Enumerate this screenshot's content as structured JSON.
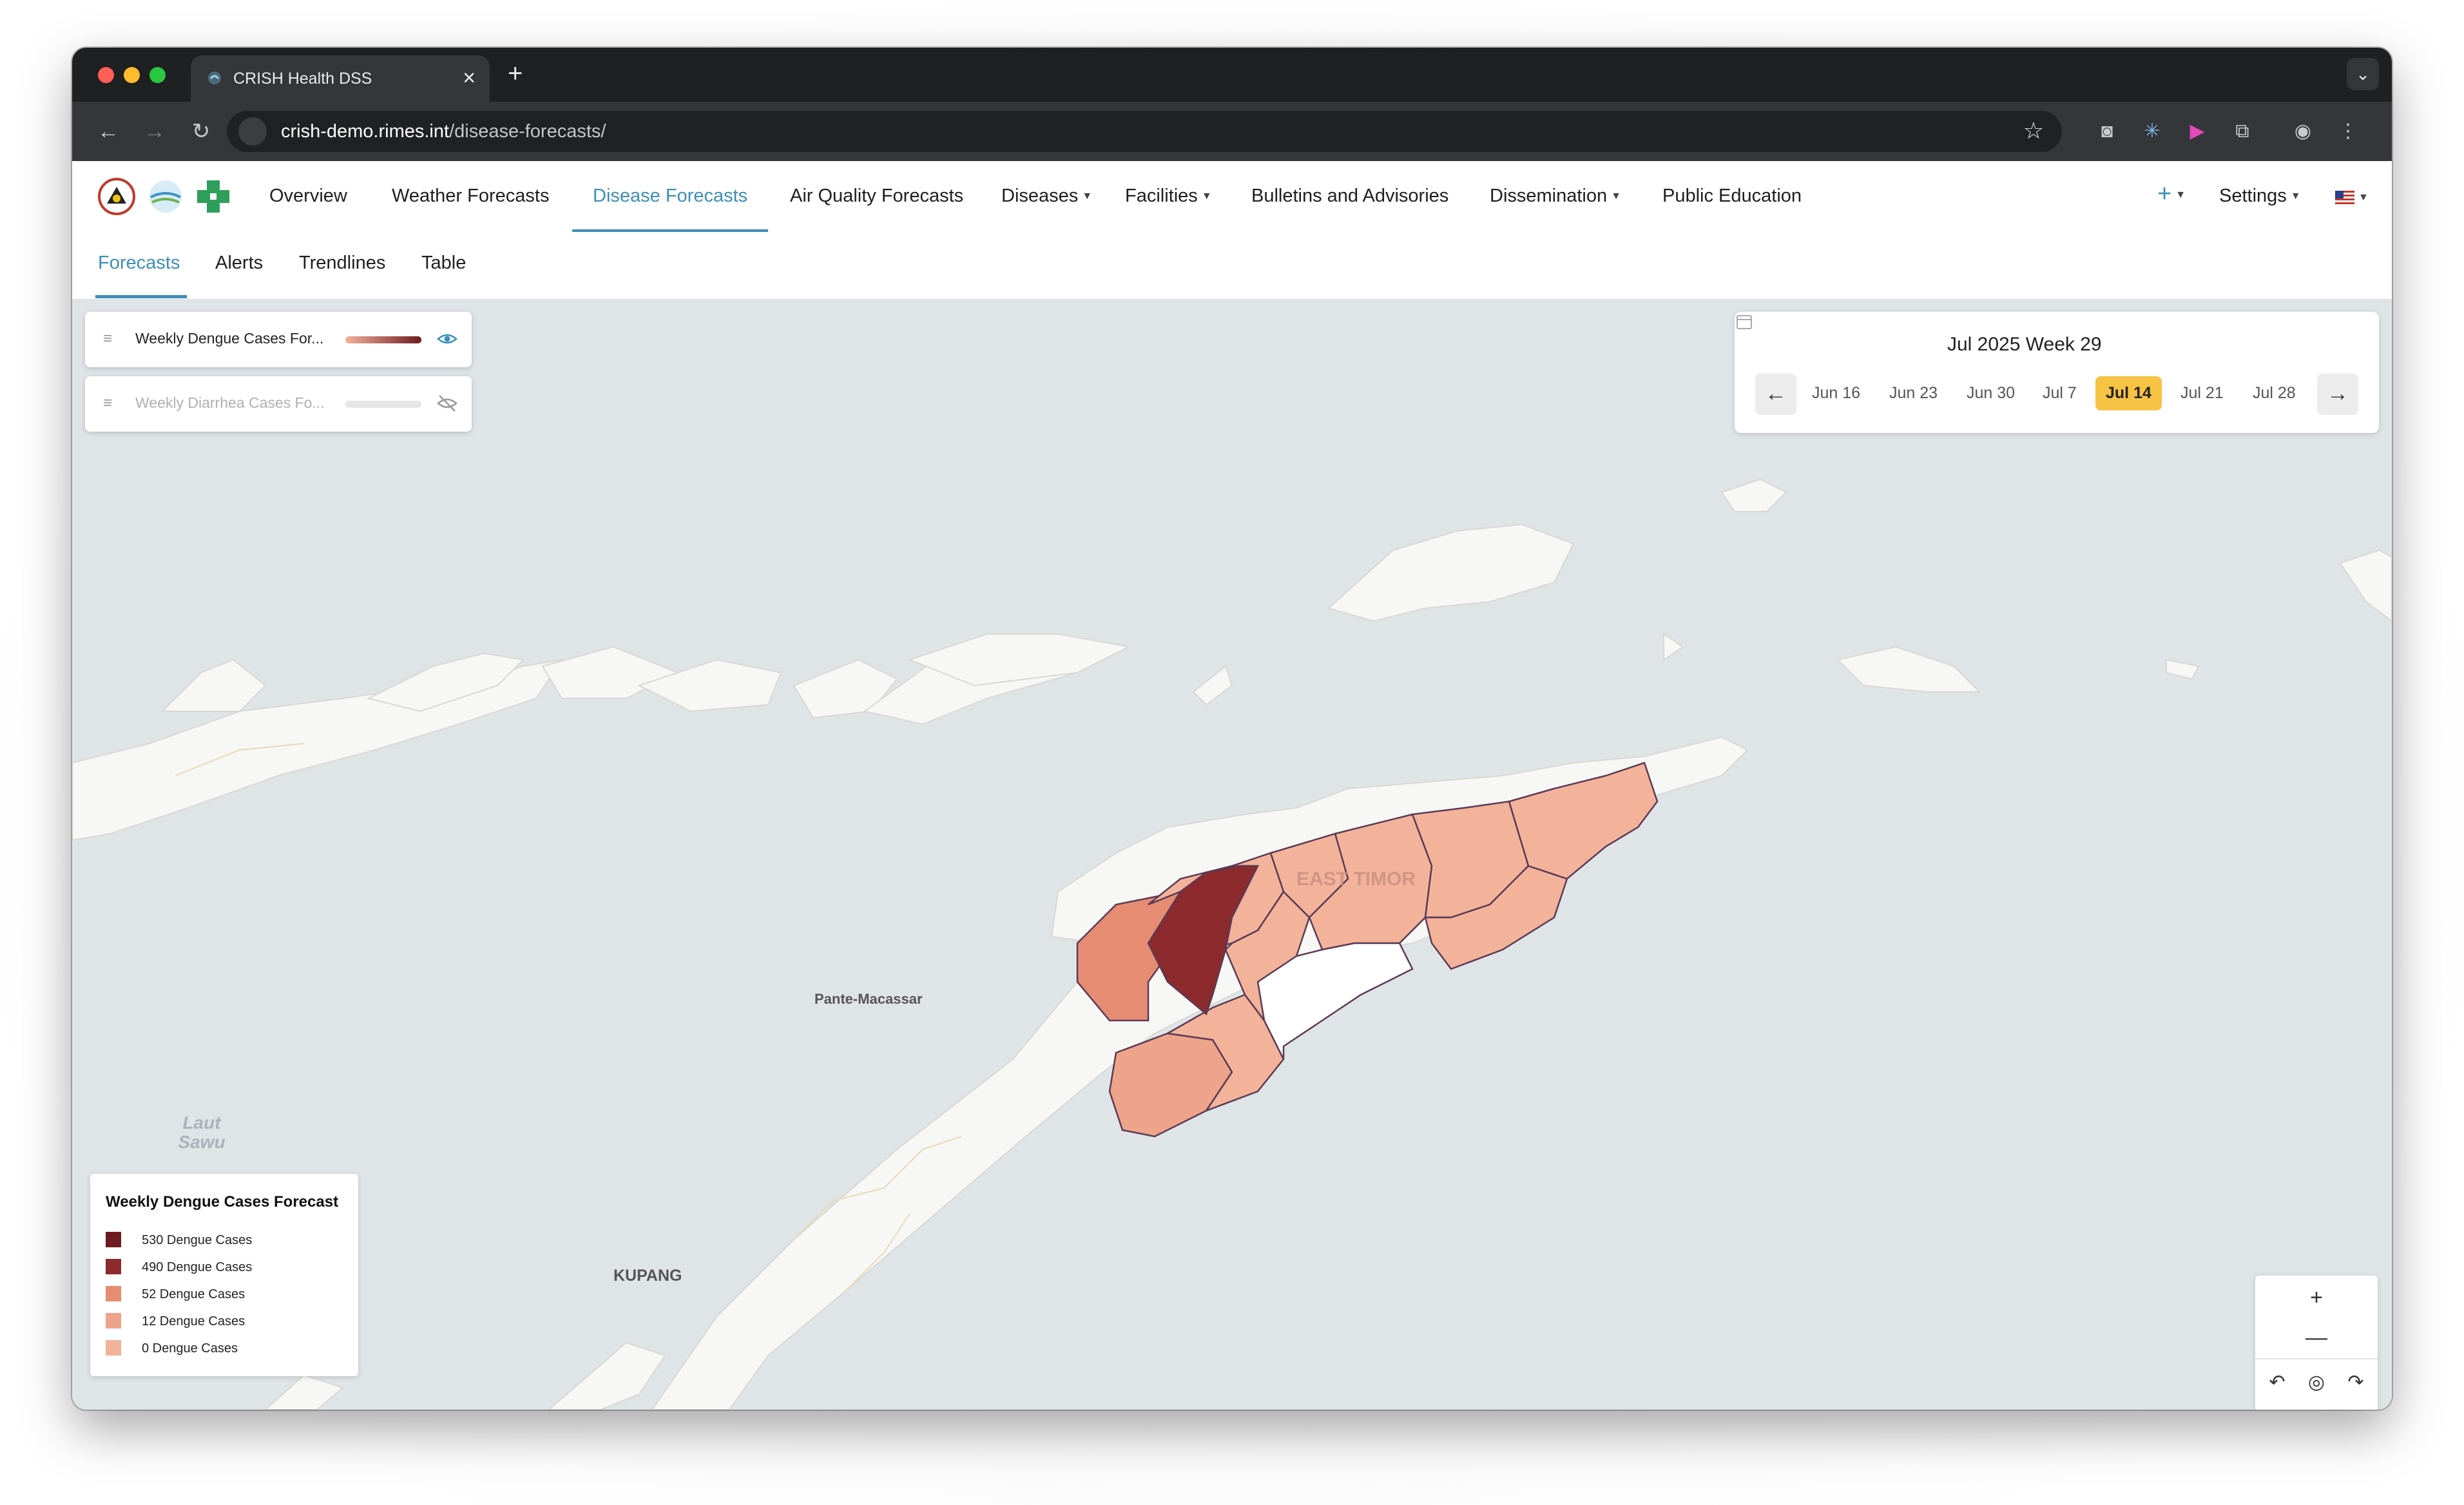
{
  "browser": {
    "tab_title": "CRISH Health DSS",
    "url_host": "crish-demo.rimes.int",
    "url_path": "/disease-forecasts/"
  },
  "nav": {
    "items": [
      "Overview",
      "Weather Forecasts",
      "Disease Forecasts",
      "Air Quality Forecasts",
      "Diseases",
      "Facilities",
      "Bulletins and Advisories",
      "Dissemination",
      "Public Education"
    ],
    "active": "Disease Forecasts",
    "settings": "Settings",
    "plus": "+"
  },
  "subnav": {
    "items": [
      "Forecasts",
      "Alerts",
      "Trendlines",
      "Table"
    ],
    "active": "Forecasts"
  },
  "layers": [
    {
      "name": "Weekly Dengue Cases For...",
      "visible": true
    },
    {
      "name": "Weekly Diarrhea Cases Fo...",
      "visible": false
    }
  ],
  "week_picker": {
    "title": "Jul 2025 Week 29",
    "weeks": [
      "Jun 16",
      "Jun 23",
      "Jun 30",
      "Jul 7",
      "Jul 14",
      "Jul 21",
      "Jul 28"
    ],
    "selected": "Jul 14",
    "prev": "←",
    "next": "→"
  },
  "map_labels": {
    "country": "EAST TIMOR",
    "city1": "Pante-Macassar",
    "city2": "KUPANG",
    "sea": "Laut Sawu"
  },
  "legend": {
    "title": "Weekly Dengue Cases Forecast",
    "entries": [
      {
        "label": "530 Dengue Cases",
        "color": "#6e1a1e"
      },
      {
        "label": "490 Dengue Cases",
        "color": "#8c2a2e"
      },
      {
        "label": "52 Dengue Cases",
        "color": "#e68c72"
      },
      {
        "label": "12 Dengue Cases",
        "color": "#eda48a"
      },
      {
        "label": "0 Dengue Cases",
        "color": "#f2b39a"
      }
    ]
  },
  "controls": {
    "zoom_in": "+",
    "zoom_out": "—"
  },
  "colors": {
    "accent": "#3c8fb7",
    "selected_week": "#f6c344",
    "water": "#dfe4e7",
    "land": "#f7f7f5"
  }
}
